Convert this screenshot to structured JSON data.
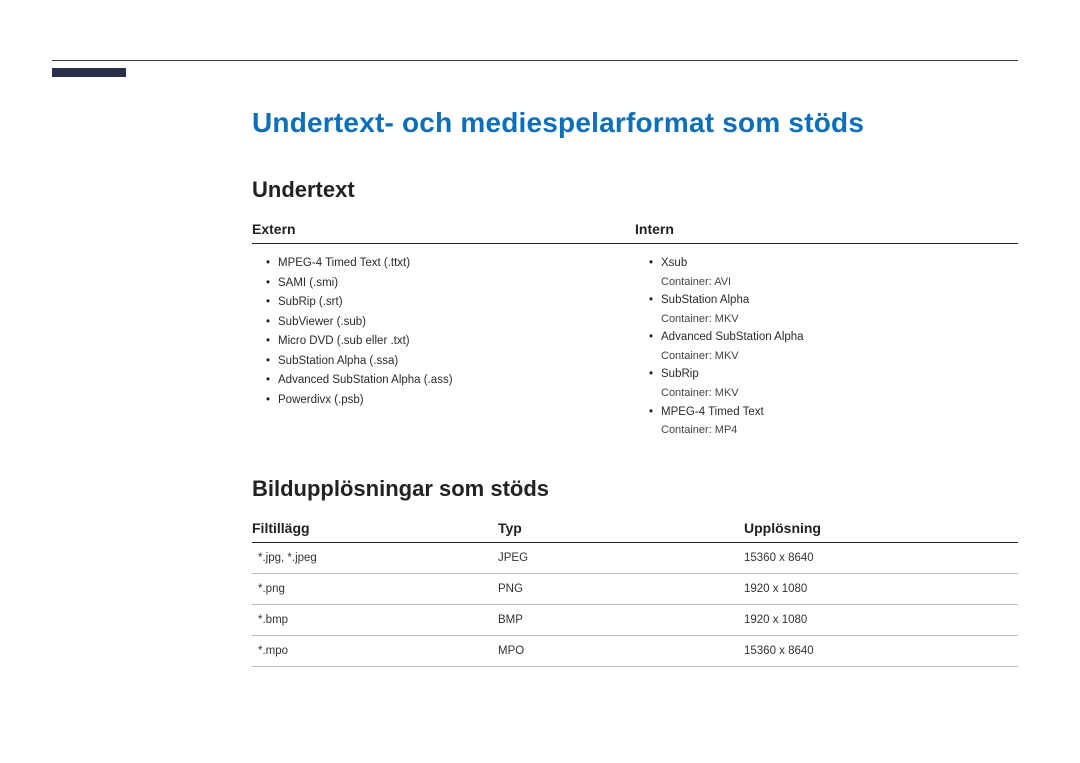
{
  "title": "Undertext- och mediespelarformat som stöds",
  "section_subtitle_1": "Undertext",
  "subtitle_table_headers": {
    "extern": "Extern",
    "intern": "Intern"
  },
  "subtitle_extern": [
    {
      "name": "MPEG-4 Timed Text (.ttxt)"
    },
    {
      "name": "SAMI (.smi)"
    },
    {
      "name": "SubRip (.srt)"
    },
    {
      "name": "SubViewer (.sub)"
    },
    {
      "name": "Micro DVD (.sub eller .txt)"
    },
    {
      "name": "SubStation Alpha (.ssa)"
    },
    {
      "name": "Advanced SubStation Alpha (.ass)"
    },
    {
      "name": "Powerdivx (.psb)"
    }
  ],
  "subtitle_intern": [
    {
      "name": "Xsub",
      "container": "Container: AVI"
    },
    {
      "name": "SubStation Alpha",
      "container": "Container: MKV"
    },
    {
      "name": "Advanced SubStation Alpha",
      "container": "Container: MKV"
    },
    {
      "name": "SubRip",
      "container": "Container: MKV"
    },
    {
      "name": "MPEG-4 Timed Text",
      "container": "Container: MP4"
    }
  ],
  "section_subtitle_2": "Bildupplösningar som stöds",
  "image_table_headers": {
    "ext": "Filtillägg",
    "type": "Typ",
    "res": "Upplösning"
  },
  "image_table_rows": [
    {
      "ext": "*.jpg, *.jpeg",
      "type": "JPEG",
      "res": "15360 x 8640"
    },
    {
      "ext": "*.png",
      "type": "PNG",
      "res": "1920 x 1080"
    },
    {
      "ext": "*.bmp",
      "type": "BMP",
      "res": "1920 x 1080"
    },
    {
      "ext": "*.mpo",
      "type": "MPO",
      "res": "15360 x 8640"
    }
  ]
}
